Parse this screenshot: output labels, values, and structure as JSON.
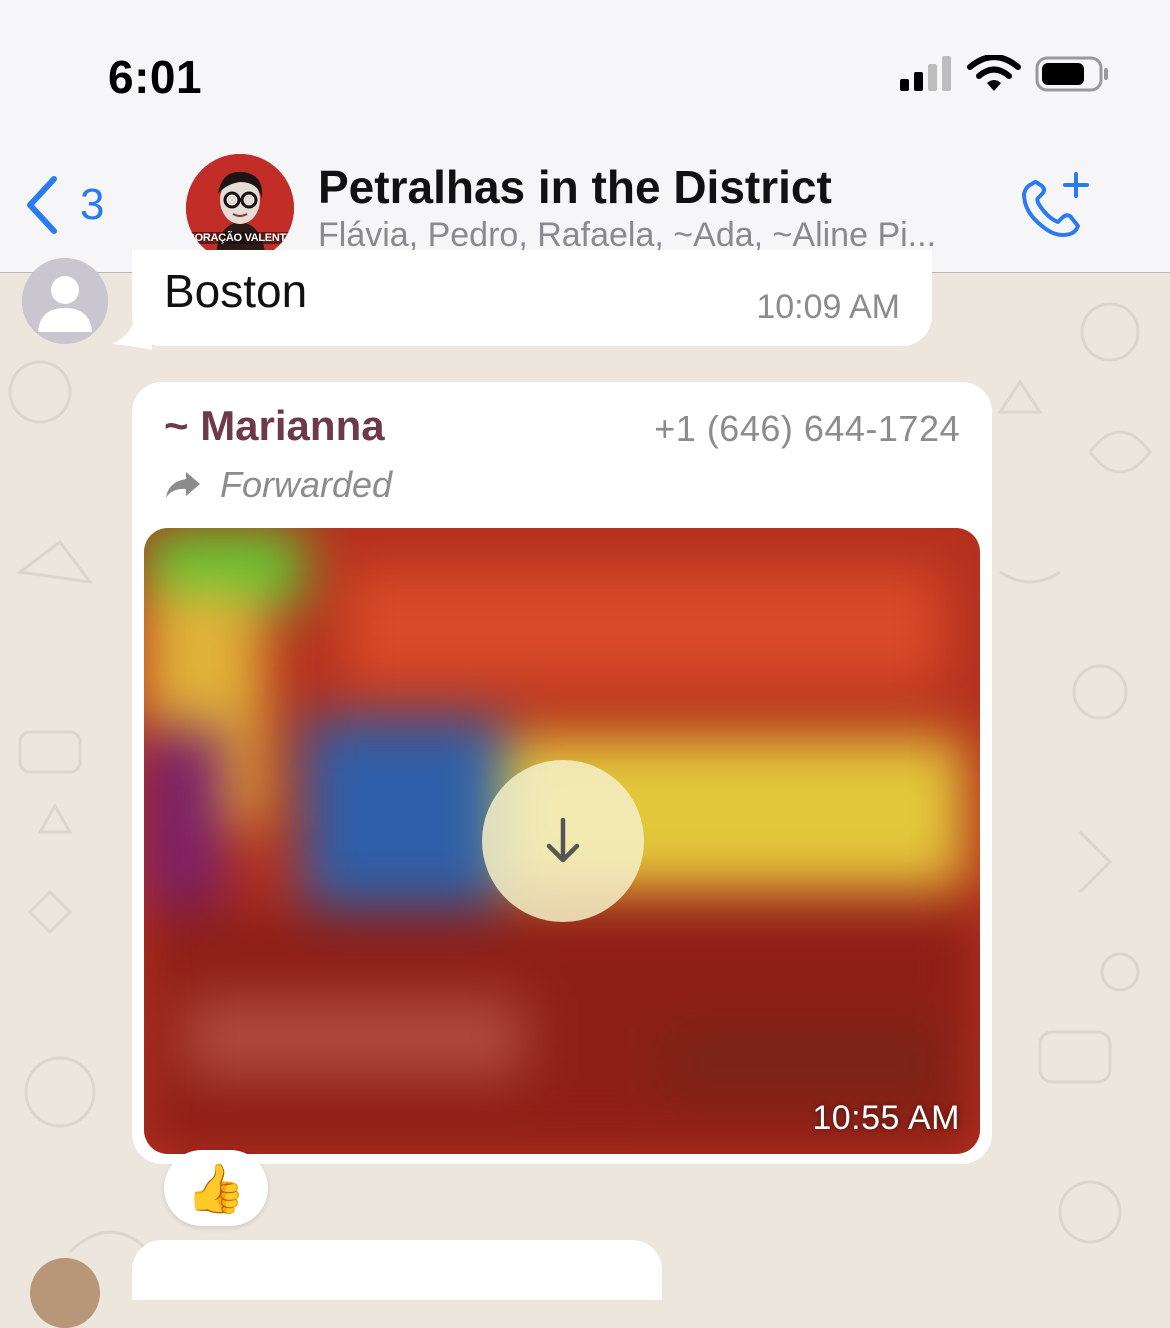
{
  "status_bar": {
    "time": "6:01",
    "icons": [
      "signal-icon",
      "wifi-icon",
      "battery-icon"
    ]
  },
  "header": {
    "back_count": "3",
    "title": "Petralhas in the District",
    "subtitle": "Flávia, Pedro, Rafaela, ~Ada, ~Aline Pi...",
    "avatar_caption": "CORAÇÃO VALENTE",
    "accent_color": "#2b7bf0"
  },
  "messages": [
    {
      "text": "Boston",
      "time": "10:09 AM"
    },
    {
      "author": "~ Marianna",
      "phone": "+1 (646) 644-1724",
      "forwarded_label": "Forwarded",
      "time": "10:55 AM",
      "reaction": "👍"
    }
  ],
  "colors": {
    "author": "#6e3a4b",
    "wallpaper": "#ece6dd"
  }
}
